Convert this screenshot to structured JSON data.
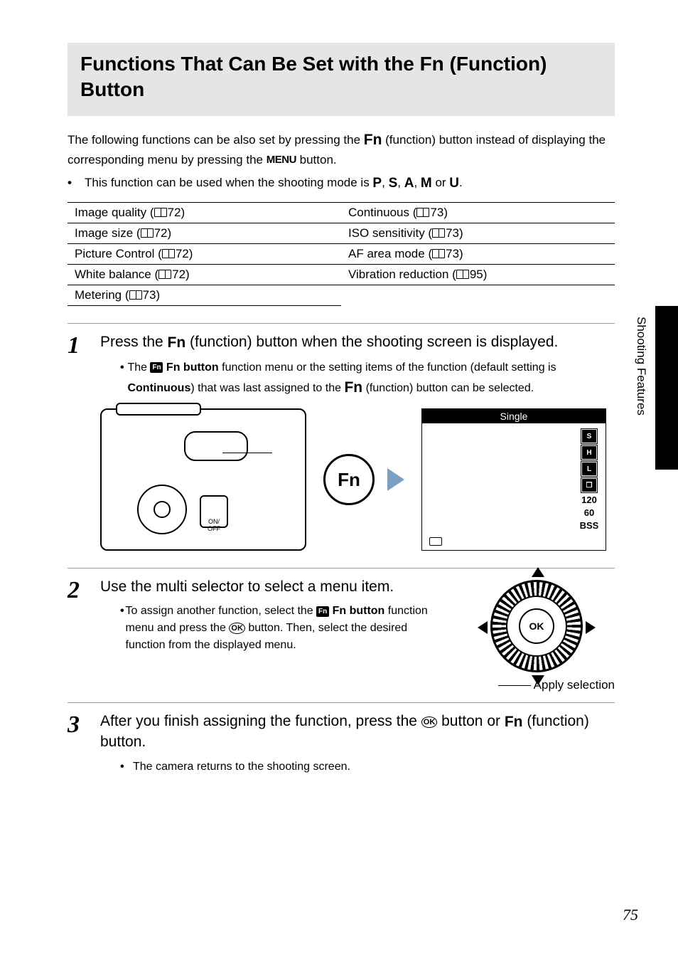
{
  "title": "Functions That Can Be Set with the Fn (Function) Button",
  "intro_a": "The following functions can be also set by pressing the ",
  "intro_b": " (function) button instead of displaying the corresponding menu by pressing the ",
  "intro_c": " button.",
  "fn_glyph": "Fn",
  "menu_glyph": "MENU",
  "bullet1_a": "This function can be used when the shooting mode is ",
  "bullet1_b": " or ",
  "bullet1_end": ".",
  "modes": {
    "p": "P",
    "s": "S",
    "a": "A",
    "m": "M",
    "u": "U"
  },
  "table": {
    "left": [
      {
        "label": "Image quality",
        "page": "72"
      },
      {
        "label": "Image size",
        "page": "72"
      },
      {
        "label": "Picture Control",
        "page": "72"
      },
      {
        "label": "White balance",
        "page": "72"
      },
      {
        "label": "Metering",
        "page": "73"
      }
    ],
    "right": [
      {
        "label": "Continuous",
        "page": "73"
      },
      {
        "label": "ISO sensitivity",
        "page": "73"
      },
      {
        "label": "AF area mode",
        "page": "73"
      },
      {
        "label": "Vibration reduction",
        "page": "95"
      }
    ]
  },
  "steps": {
    "s1": {
      "num": "1",
      "head_a": "Press the ",
      "head_b": " (function) button when the shooting screen is displayed.",
      "sub_a": "The ",
      "sub_b": " Fn button",
      "sub_c": " function menu or the setting items of the function (default setting is ",
      "sub_d": "Continuous",
      "sub_e": ") that was last assigned to the ",
      "sub_f": " (function) button can be selected."
    },
    "s2": {
      "num": "2",
      "head": "Use the multi selector to select a menu item.",
      "sub_a": "To assign another function, select the ",
      "sub_b": " Fn button",
      "sub_c": " function menu and press the ",
      "sub_d": " button. Then, select the desired function from the displayed menu.",
      "apply": "Apply selection"
    },
    "s3": {
      "num": "3",
      "head_a": "After you finish assigning the function, press the ",
      "head_b": " button or ",
      "head_c": " (function) button.",
      "sub": "The camera returns to the shooting screen."
    }
  },
  "figures": {
    "fn_circle": "Fn",
    "camera_on": "ON/\nOFF",
    "screen_title": "Single",
    "screen_icons": [
      "S",
      "H",
      "L",
      "❐"
    ],
    "screen_nums": [
      "120",
      "60",
      "BSS"
    ],
    "ok": "OK"
  },
  "side_label": "Shooting Features",
  "page_number": "75"
}
